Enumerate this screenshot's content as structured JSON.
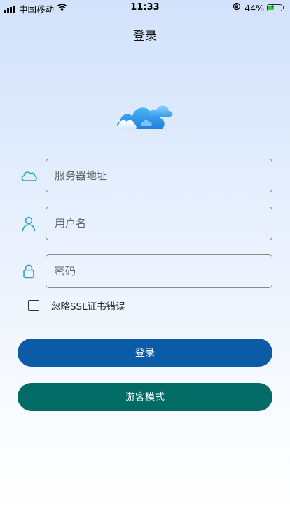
{
  "status_bar": {
    "carrier": "中国移动",
    "time": "11:33",
    "battery_percent": "44%",
    "battery_level": 0.44
  },
  "header": {
    "title": "登录"
  },
  "form": {
    "server_placeholder": "服务器地址",
    "username_placeholder": "用户名",
    "password_placeholder": "密码",
    "ignore_ssl_label": "忽略SSL证书错误",
    "ignore_ssl_checked": false
  },
  "buttons": {
    "login_label": "登录",
    "guest_label": "游客模式"
  },
  "colors": {
    "login_button": "#0b5ba6",
    "guest_button": "#026b66",
    "icon_accent": "#2aa3c9"
  },
  "icons": {
    "logo": "cloud-logo-icon",
    "server": "cloud-icon",
    "username": "user-icon",
    "password": "lock-icon"
  }
}
